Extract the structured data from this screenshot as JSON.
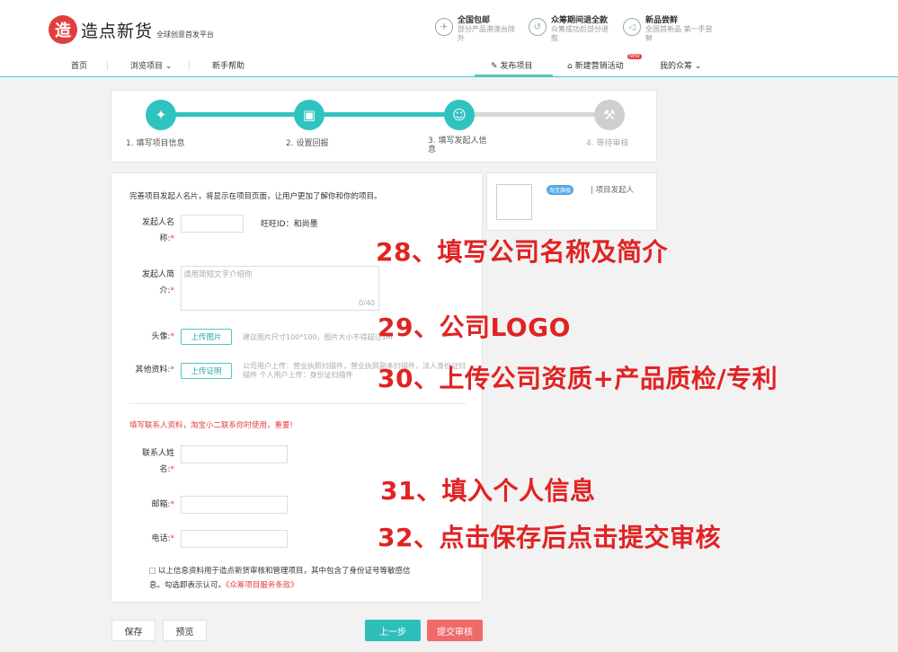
{
  "header": {
    "logo_mark": "造",
    "logo_name": "造点新货",
    "logo_tagline": "全球创意首发平台",
    "promos": [
      {
        "title": "全国包邮",
        "sub": "部分产品港澳台除外",
        "icon": "truck-icon",
        "glyph": "✈"
      },
      {
        "title": "众筹期间退全款",
        "sub": "众筹成功后部分退款",
        "icon": "refund-icon",
        "glyph": "↺"
      },
      {
        "title": "新品尝鲜",
        "sub": "全国首新品 第一手尝鲜",
        "icon": "megaphone-icon",
        "glyph": "◁"
      }
    ]
  },
  "nav": {
    "home": "首页",
    "browse": "浏览项目",
    "help": "新手帮助",
    "publish": "发布项目",
    "campaign": "新建营销活动",
    "campaign_badge": "NEW",
    "my_crowdfunding": "我的众筹"
  },
  "steps": [
    {
      "label": "1. 填写项目信息",
      "icon": "lightbulb-icon",
      "glyph": "✦",
      "state": "done"
    },
    {
      "label": "2. 设置回报",
      "icon": "gift-icon",
      "glyph": "▣",
      "state": "done"
    },
    {
      "label": "3. 填写发起人信息",
      "icon": "user-icon",
      "glyph": "☺",
      "state": "active"
    },
    {
      "label": "4. 等待审核",
      "icon": "gavel-icon",
      "glyph": "⚒",
      "state": "pending"
    }
  ],
  "form": {
    "intro": "完善项目发起人名片，将显示在项目页面，让用户更加了解你和你的项目。",
    "sponsor_name_label": "发起人名称:",
    "wangwang_id": "旺旺ID：和尚墨",
    "sponsor_intro_label": "发起人简介:",
    "sponsor_intro_placeholder": "请用简短文字介绍你",
    "sponsor_intro_counter": "0/40",
    "avatar_label": "头像:",
    "avatar_button": "上传图片",
    "avatar_hint": "建议图片尺寸100*100，图片大小不得超过1M",
    "other_docs_label": "其他资料:",
    "other_docs_button": "上传证明",
    "other_docs_hint": "公司用户上传：营业执照扫描件，营业执照副本扫描件，法人身份证扫描件 个人用户上传：身份证扫描件",
    "contact_warning": "填写联系人资料，淘宝小二联系你时使用，重要!",
    "contact_name_label": "联系人姓名:",
    "email_label": "邮箱:",
    "phone_label": "电话:",
    "agreement_text": "以上信息资料用于造点新货审核和管理项目，其中包含了身份证号等敏感信息。勾选即表示认可。",
    "agreement_link": "《众筹项目服务条款》",
    "required_mark": "*"
  },
  "card": {
    "badge": "淘宝旗舰",
    "role": "| 项目发起人"
  },
  "buttons": {
    "save": "保存",
    "preview": "预览",
    "prev": "上一步",
    "submit": "提交审核"
  },
  "annotations": [
    "28、填写公司名称及简介",
    "29、公司LOGO",
    "30、上传公司资质+产品质检/专利",
    "31、填入个人信息",
    "32、点击保存后点击提交审核"
  ],
  "colors": {
    "accent": "#4cc7c4",
    "brand_red": "#e33e3e",
    "annotation_red": "#e02323"
  }
}
